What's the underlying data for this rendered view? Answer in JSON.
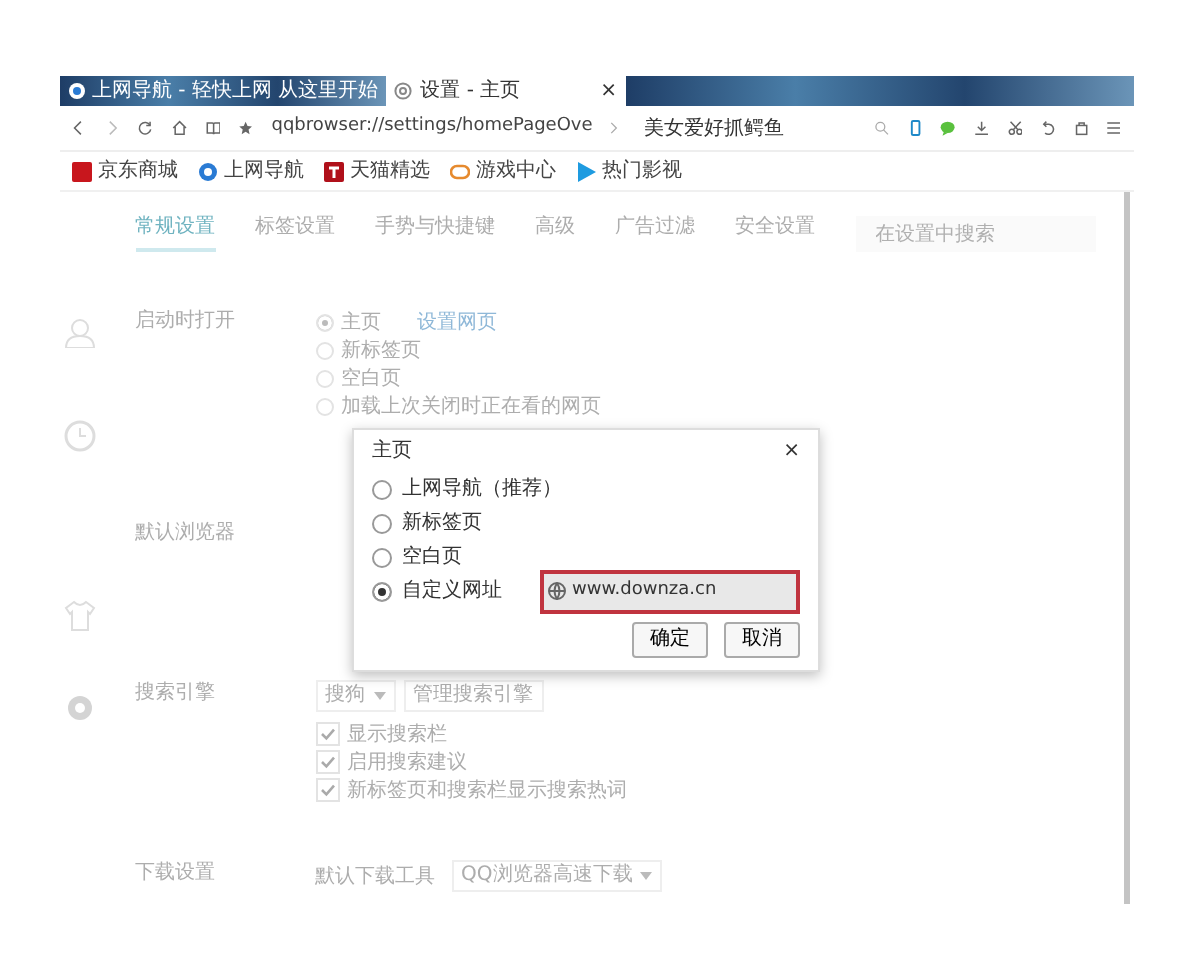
{
  "browser_tabs": [
    {
      "title": "上网导航 - 轻快上网 从这里开始",
      "selected": false
    },
    {
      "title": "设置 - 主页",
      "selected": true,
      "close": "×"
    }
  ],
  "address_bar": {
    "url": "qqbrowser://settings/homePageOve",
    "search": "美女爱好抓鳄鱼"
  },
  "bookmarks": [
    "京东商城",
    "上网导航",
    "天猫精选",
    "游戏中心",
    "热门影视"
  ],
  "settings_tabs": [
    {
      "label": "常规设置",
      "selected": true
    },
    {
      "label": "标签设置",
      "selected": false
    },
    {
      "label": "手势与快捷键",
      "selected": false
    },
    {
      "label": "高级",
      "selected": false
    },
    {
      "label": "广告过滤",
      "selected": false
    },
    {
      "label": "安全设置",
      "selected": false
    }
  ],
  "settings_search": {
    "placeholder": "在设置中搜索"
  },
  "sections": [
    {
      "title": "启动时打开",
      "kind": "radios",
      "options": [
        {
          "label": "主页",
          "selected": true,
          "link": "设置网页"
        },
        {
          "label": "新标签页",
          "selected": false
        },
        {
          "label": "空白页",
          "selected": false
        },
        {
          "label": "加载上次关闭时正在看的网页",
          "selected": false
        }
      ]
    },
    {
      "title": "默认浏览器",
      "kind": "blank"
    },
    {
      "title": "搜索引擎",
      "kind": "search",
      "engine": "搜狗",
      "button": "管理搜索引擎",
      "checks": [
        {
          "label": "显示搜索栏",
          "checked": true
        },
        {
          "label": "启用搜索建议",
          "checked": true
        },
        {
          "label": "新标签页和搜索栏显示搜索热词",
          "checked": true
        }
      ]
    },
    {
      "title": "下载设置",
      "kind": "download",
      "label": "默认下载工具",
      "tool": "QQ浏览器高速下载"
    }
  ],
  "dialog": {
    "title": "主页",
    "options": [
      {
        "label": "上网导航（推荐）",
        "selected": false
      },
      {
        "label": "新标签页",
        "selected": false
      },
      {
        "label": "空白页",
        "selected": false
      },
      {
        "label": "自定义网址",
        "selected": true
      }
    ],
    "close": "×",
    "url": "www.downza.cn",
    "highlighted": true,
    "buttons": [
      "确定",
      "取消"
    ]
  }
}
